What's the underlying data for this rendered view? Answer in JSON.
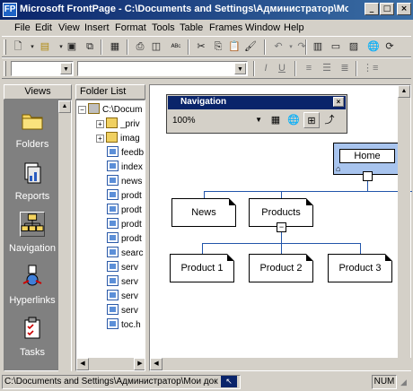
{
  "window": {
    "title": "Microsoft FrontPage - C:\\Documents and Settings\\Администратор\\Мои д...",
    "app_icon": "FP",
    "minimize_glyph": "_",
    "maximize_glyph": "□",
    "close_glyph": "×"
  },
  "menu": {
    "items": [
      "File",
      "Edit",
      "View",
      "Insert",
      "Format",
      "Tools",
      "Table",
      "Frames",
      "Window",
      "Help"
    ]
  },
  "views": {
    "header": "Views",
    "items": [
      {
        "label": "Folders",
        "icon": "folder-icon"
      },
      {
        "label": "Reports",
        "icon": "reports-icon"
      },
      {
        "label": "Navigation",
        "icon": "navigation-icon"
      },
      {
        "label": "Hyperlinks",
        "icon": "hyperlinks-icon"
      },
      {
        "label": "Tasks",
        "icon": "tasks-icon"
      }
    ],
    "active": "Navigation"
  },
  "folder_list": {
    "header": "Folder List",
    "root": "C:\\Docum",
    "folders": [
      "_priv",
      "imag"
    ],
    "files": [
      "feedb",
      "index",
      "news",
      "prodt",
      "prodt",
      "prodt",
      "prodt",
      "searc",
      "serv",
      "serv",
      "serv",
      "serv",
      "toc.h"
    ]
  },
  "navigation": {
    "title": "Navigation",
    "zoom": "100%",
    "close_glyph": "×",
    "home": "Home",
    "level1": [
      "News",
      "Products"
    ],
    "level2": [
      "Product 1",
      "Product 2",
      "Product 3"
    ],
    "collapse_glyph": "−"
  },
  "statusbar": {
    "path": "C:\\Documents and Settings\\Администратор\\Мои док",
    "mode": "NUM"
  },
  "colors": {
    "titlebar": "#0a246a",
    "panel": "#d4d0c8",
    "views_bg": "#808080",
    "home_node": "#a8c4ee",
    "connector": "#2255aa"
  }
}
